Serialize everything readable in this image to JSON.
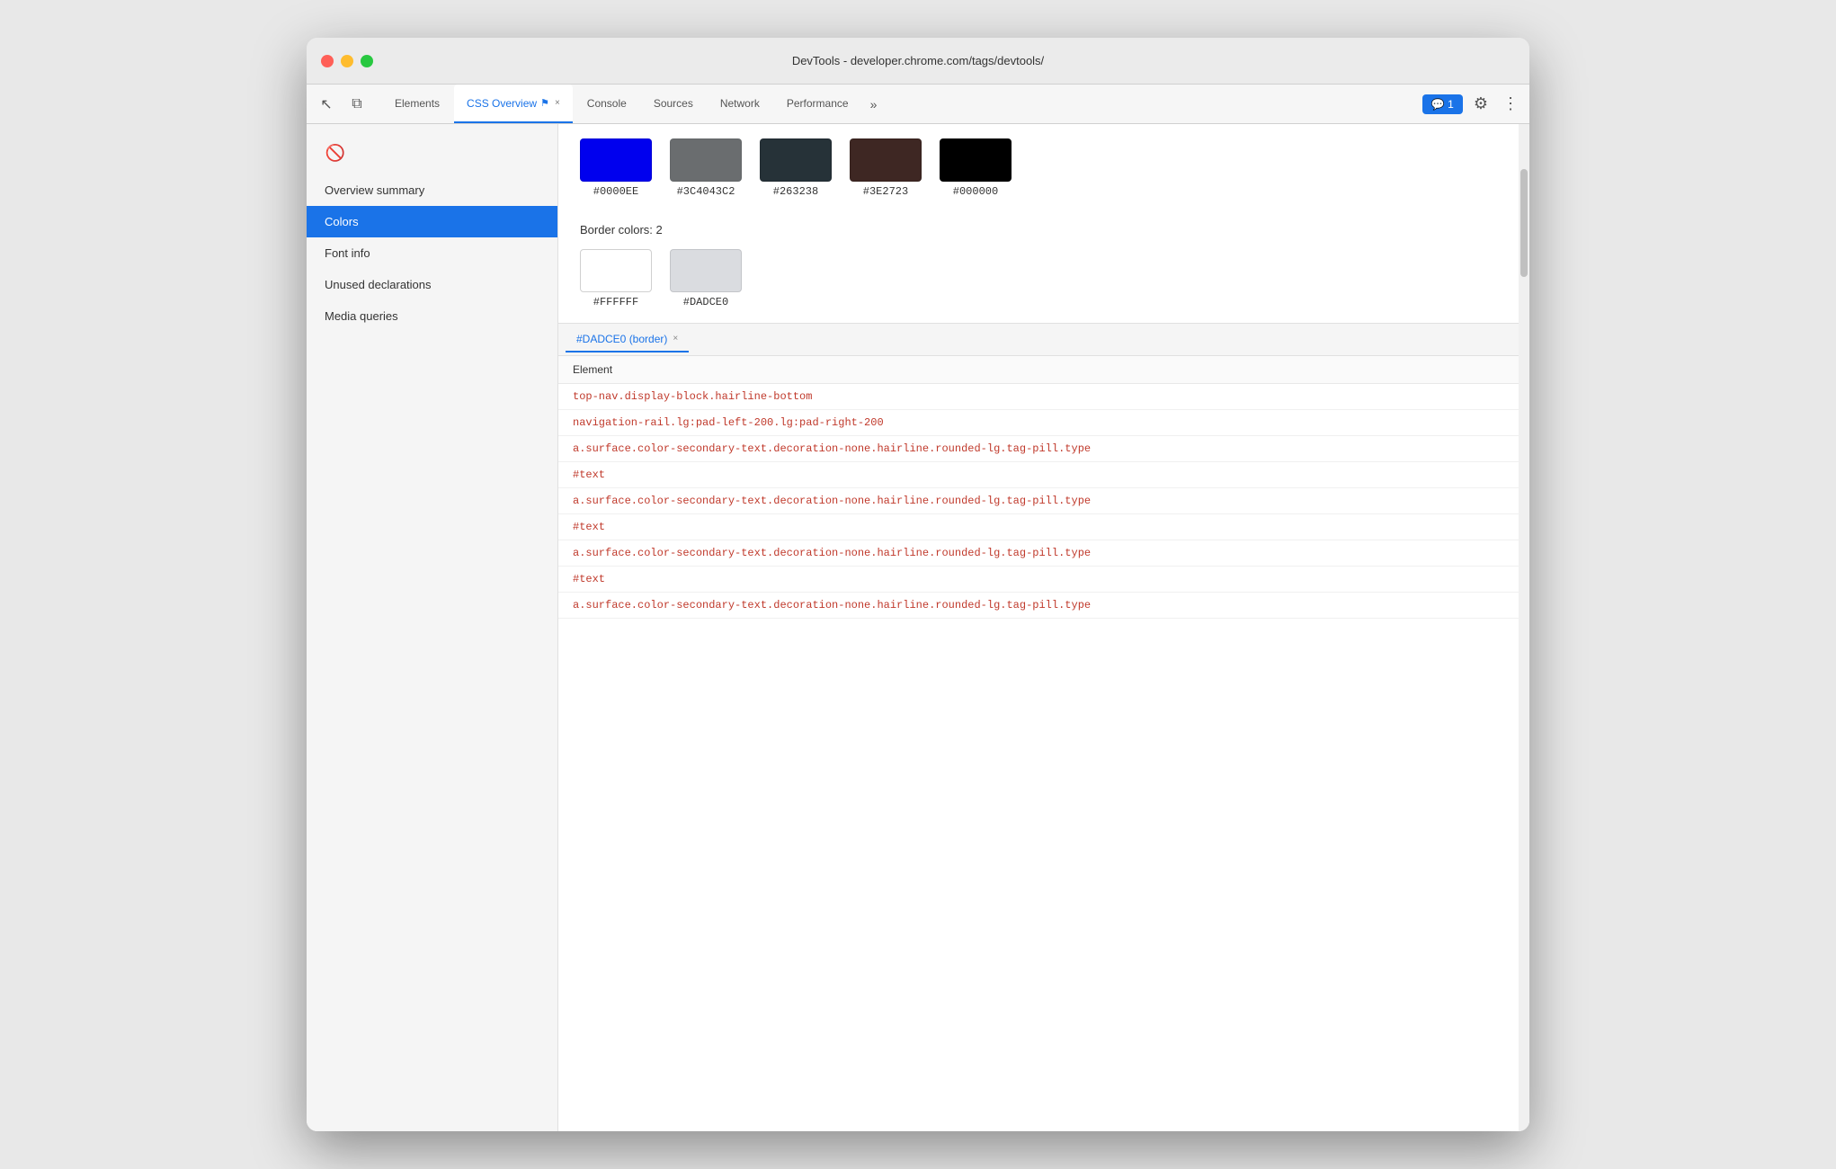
{
  "window": {
    "title": "DevTools - developer.chrome.com/tags/devtools/"
  },
  "tabbar": {
    "tabs": [
      {
        "label": "Elements",
        "active": false,
        "closeable": false,
        "id": "elements"
      },
      {
        "label": "CSS Overview",
        "active": true,
        "closeable": true,
        "warning": "⚑",
        "id": "css-overview"
      },
      {
        "label": "Console",
        "active": false,
        "closeable": false,
        "id": "console"
      },
      {
        "label": "Sources",
        "active": false,
        "closeable": false,
        "id": "sources"
      },
      {
        "label": "Network",
        "active": false,
        "closeable": false,
        "id": "network"
      },
      {
        "label": "Performance",
        "active": false,
        "closeable": false,
        "id": "performance"
      }
    ],
    "more_label": "»",
    "badge": "💬 1",
    "gear": "⚙",
    "more": "⋮"
  },
  "sidebar": {
    "items": [
      {
        "label": "Overview summary",
        "active": false,
        "id": "overview-summary"
      },
      {
        "label": "Colors",
        "active": true,
        "id": "colors"
      },
      {
        "label": "Font info",
        "active": false,
        "id": "font-info"
      },
      {
        "label": "Unused declarations",
        "active": false,
        "id": "unused-declarations"
      },
      {
        "label": "Media queries",
        "active": false,
        "id": "media-queries"
      }
    ]
  },
  "colors": {
    "top_swatches": [
      {
        "hex": "#0000EE",
        "color": "#0000EE"
      },
      {
        "hex": "#3C4043C2",
        "color": "#3C4043"
      },
      {
        "hex": "#263238",
        "color": "#263238"
      },
      {
        "hex": "#3E2723",
        "color": "#3E2723"
      },
      {
        "hex": "#000000",
        "color": "#000000"
      }
    ],
    "border_section_title": "Border colors: 2",
    "border_swatches": [
      {
        "hex": "#FFFFFF",
        "color": "#FFFFFF"
      },
      {
        "hex": "#DADCE0",
        "color": "#DADCE0"
      }
    ]
  },
  "element_panel": {
    "active_tab_label": "#DADCE0 (border)",
    "close_label": "×",
    "header_label": "Element",
    "elements": [
      {
        "text": "top-nav.display-block.hairline-bottom",
        "type": "selector"
      },
      {
        "text": "navigation-rail.lg:pad-left-200.lg:pad-right-200",
        "type": "selector"
      },
      {
        "text": "a.surface.color-secondary-text.decoration-none.hairline.rounded-lg.tag-pill.type",
        "type": "selector"
      },
      {
        "text": "#text",
        "type": "text-node"
      },
      {
        "text": "a.surface.color-secondary-text.decoration-none.hairline.rounded-lg.tag-pill.type",
        "type": "selector"
      },
      {
        "text": "#text",
        "type": "text-node"
      },
      {
        "text": "a.surface.color-secondary-text.decoration-none.hairline.rounded-lg.tag-pill.type",
        "type": "selector"
      },
      {
        "text": "#text",
        "type": "text-node"
      },
      {
        "text": "a.surface.color-secondary-text.decoration-none.hairline.rounded-lg.tag-pill.type",
        "type": "selector"
      }
    ]
  },
  "icons": {
    "cursor": "↖",
    "layers": "⧉",
    "no_entry": "🚫"
  }
}
